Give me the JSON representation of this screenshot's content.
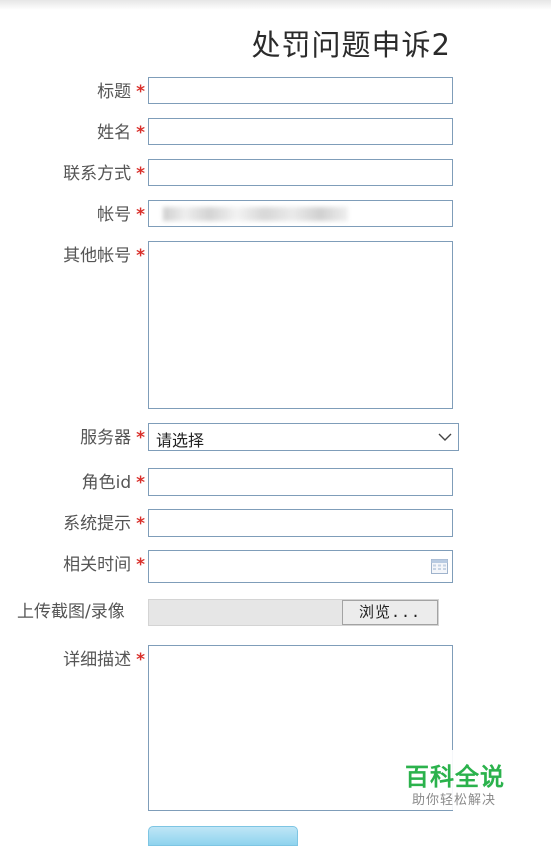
{
  "form": {
    "title": "处罚问题申诉2",
    "required_mark": "*",
    "fields": {
      "subject": {
        "label": "标题",
        "value": ""
      },
      "name": {
        "label": "姓名",
        "value": ""
      },
      "contact": {
        "label": "联系方式",
        "value": ""
      },
      "account": {
        "label": "帐号"
      },
      "other_accounts": {
        "label": "其他帐号",
        "value": ""
      },
      "server": {
        "label": "服务器",
        "selected": "请选择"
      },
      "role_id": {
        "label": "角色id",
        "value": ""
      },
      "system_prompt": {
        "label": "系统提示",
        "value": ""
      },
      "related_time": {
        "label": "相关时间",
        "value": ""
      },
      "upload": {
        "label": "上传截图/录像",
        "browse_label": "浏览..."
      },
      "description": {
        "label": "详细描述",
        "value": ""
      }
    }
  },
  "watermark": {
    "title": "百科全说",
    "subtitle": "助你轻松解决"
  },
  "colors": {
    "required": "#d9302b",
    "border": "#7f9db9",
    "watermark": "#2bb24c"
  },
  "icons": [
    "chevron-down-icon",
    "calendar-icon"
  ]
}
